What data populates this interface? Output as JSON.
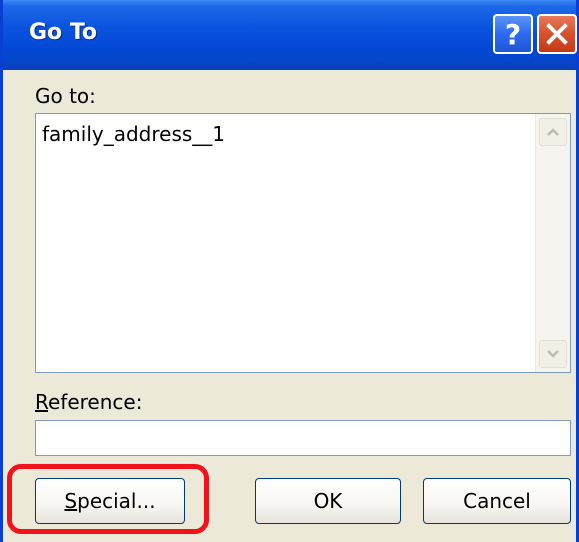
{
  "window": {
    "title": "Go To",
    "help_icon": "help-icon",
    "close_icon": "close-icon"
  },
  "goto": {
    "label": "Go to:",
    "items": [
      "family_address__1"
    ]
  },
  "reference": {
    "label_first": "R",
    "label_rest": "eference:",
    "value": ""
  },
  "buttons": {
    "special_first": "S",
    "special_rest": "pecial...",
    "ok": "OK",
    "cancel": "Cancel"
  },
  "colors": {
    "titlebar": "#0A53DE",
    "highlight": "#F2121B",
    "dialog_bg": "#ECE9D8"
  }
}
